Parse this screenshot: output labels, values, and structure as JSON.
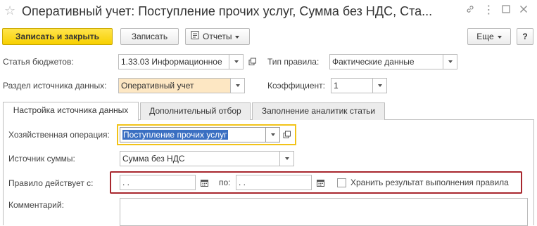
{
  "window": {
    "title": "Оперативный учет: Поступление прочих услуг, Сумма без НДС, Ста...",
    "star_icon": "star-icon",
    "link_icon": "link-icon",
    "more_icon": "more-icon",
    "maximize_icon": "maximize-icon",
    "close_icon": "close-icon"
  },
  "toolbar": {
    "save_close_label": "Записать и закрыть",
    "save_label": "Записать",
    "reports_label": "Отчеты",
    "more_label": "Еще",
    "help_label": "?"
  },
  "form": {
    "budget_item_label": "Статья бюджетов:",
    "budget_item_value": "1.33.03 Информационное",
    "rule_type_label": "Тип правила:",
    "rule_type_value": "Фактические данные",
    "data_source_section_label": "Раздел источника данных:",
    "data_source_section_value": "Оперативный учет",
    "coefficient_label": "Коэффициент:",
    "coefficient_value": "1"
  },
  "tabs": [
    {
      "label": "Настройка источника данных",
      "active": true
    },
    {
      "label": "Дополнительный отбор",
      "active": false
    },
    {
      "label": "Заполнение аналитик статьи",
      "active": false
    }
  ],
  "panel": {
    "operation_label": "Хозяйственная операция:",
    "operation_value": "Поступление прочих услуг",
    "amount_source_label": "Источник суммы:",
    "amount_source_value": "Сумма без НДС",
    "rule_valid_label": "Правило действует с:",
    "date_from_value": " .  .",
    "to_label": "по:",
    "date_to_value": " .  .",
    "keep_result_label": "Хранить результат выполнения правила",
    "keep_result_checked": false,
    "comment_label": "Комментарий:",
    "comment_value": ""
  },
  "colors": {
    "primary_button": "#f7d000",
    "highlight_field": "#fde7c3",
    "focus_border": "#f2c318",
    "annotation_frame": "#a8272e",
    "selection": "#3a6fc2"
  }
}
